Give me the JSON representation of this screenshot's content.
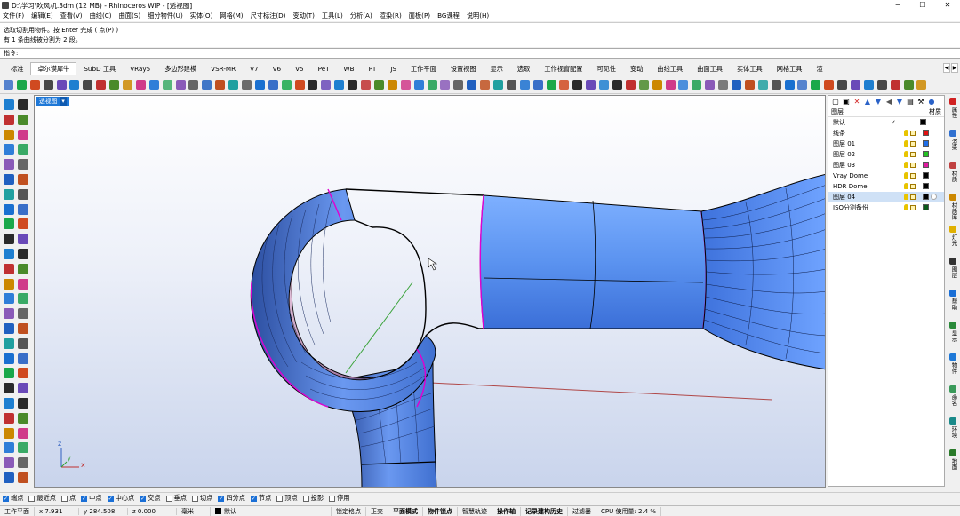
{
  "window": {
    "title": "D:\\学习\\吹风机.3dm (12 MB) - Rhinoceros WIP - [透视图]",
    "min": "─",
    "max": "☐",
    "close": "✕"
  },
  "menu": [
    "文件(F)",
    "编辑(E)",
    "查看(V)",
    "曲线(C)",
    "曲面(S)",
    "细分物件(U)",
    "实体(O)",
    "网格(M)",
    "尺寸标注(D)",
    "变动(T)",
    "工具(L)",
    "分析(A)",
    "渲染(R)",
    "面板(P)",
    "BG课程",
    "说明(H)"
  ],
  "command_history": [
    "选取切割用物件。按 Enter 完成 ( 点(P) )",
    "有 1 条曲线被分割为 2 段。"
  ],
  "command_prompt": "指令:",
  "toolbar_tabs": [
    {
      "label": "标准",
      "active": false
    },
    {
      "label": "卓尔谟犀牛",
      "active": true
    },
    {
      "label": "SubD 工具",
      "active": false
    },
    {
      "label": "VRay5",
      "active": false
    },
    {
      "label": "多边形建模",
      "active": false
    },
    {
      "label": "VSR-MR",
      "active": false
    },
    {
      "label": "V7",
      "active": false
    },
    {
      "label": "V6",
      "active": false
    },
    {
      "label": "V5",
      "active": false
    },
    {
      "label": "PeT",
      "active": false
    },
    {
      "label": "WB",
      "active": false
    },
    {
      "label": "PT",
      "active": false
    },
    {
      "label": "JS",
      "active": false
    },
    {
      "label": "工作平面",
      "active": false
    },
    {
      "label": "设置视图",
      "active": false
    },
    {
      "label": "显示",
      "active": false
    },
    {
      "label": "选取",
      "active": false
    },
    {
      "label": "工作视窗配置",
      "active": false
    },
    {
      "label": "可见性",
      "active": false
    },
    {
      "label": "变动",
      "active": false
    },
    {
      "label": "曲线工具",
      "active": false
    },
    {
      "label": "曲面工具",
      "active": false
    },
    {
      "label": "实体工具",
      "active": false
    },
    {
      "label": "网格工具",
      "active": false
    },
    {
      "label": "渲",
      "active": false
    }
  ],
  "tab_scroll": {
    "left": "◀",
    "right": "▶"
  },
  "viewport": {
    "label": "透视图",
    "dropdown": "▾",
    "axis_x": "x",
    "axis_y": "y",
    "axis_z": "z"
  },
  "layers_panel": {
    "header_left": "图层",
    "header_right": "材质",
    "layers": [
      {
        "name": "默认",
        "current": true,
        "color": "#000000",
        "selected": false
      },
      {
        "name": "线条",
        "current": false,
        "color": "#e01010",
        "selected": false
      },
      {
        "name": "图层 01",
        "current": false,
        "color": "#1e6ee8",
        "selected": false
      },
      {
        "name": "图层 02",
        "current": false,
        "color": "#22c022",
        "selected": false
      },
      {
        "name": "图层 03",
        "current": false,
        "color": "#e01aa0",
        "selected": false
      },
      {
        "name": "Vray Dome",
        "current": false,
        "color": "#000000",
        "selected": false
      },
      {
        "name": "HDR Dome",
        "current": false,
        "color": "#000000",
        "selected": false
      },
      {
        "name": "图层 04",
        "current": false,
        "color": "#000000",
        "selected": true
      },
      {
        "name": "ISO分割备份",
        "current": false,
        "color": "#0a5a1a",
        "selected": false
      }
    ],
    "current_mark": "✓"
  },
  "right_tabs": [
    "属性",
    "渲染",
    "材质",
    "材质库",
    "灯光",
    "图层",
    "帮助",
    "显示",
    "物件",
    "命名",
    "环境",
    "地面"
  ],
  "osnaps": [
    {
      "label": "端点",
      "on": true
    },
    {
      "label": "最近点",
      "on": false
    },
    {
      "label": "点",
      "on": false
    },
    {
      "label": "中点",
      "on": true
    },
    {
      "label": "中心点",
      "on": true
    },
    {
      "label": "交点",
      "on": true
    },
    {
      "label": "垂点",
      "on": false
    },
    {
      "label": "切点",
      "on": false
    },
    {
      "label": "四分点",
      "on": true
    },
    {
      "label": "节点",
      "on": true
    },
    {
      "label": "顶点",
      "on": false
    },
    {
      "label": "投影",
      "on": false
    },
    {
      "label": "停用",
      "on": false
    }
  ],
  "status": {
    "cplane": "工作平面",
    "x": "x 7.931",
    "y": "y 284.508",
    "z": "z 0.000",
    "unit": "毫米",
    "layer": "默认",
    "toggles": [
      "锁定格点",
      "正交",
      "平面模式",
      "物件锁点",
      "智慧轨迹",
      "操作轴",
      "记录建构历史",
      "过滤器"
    ],
    "cpu": "CPU 使用量: 2.4 %"
  },
  "colors": {
    "accent": "#1e78d7",
    "surface": "#5b93f0",
    "edge_highlight": "#e000d0"
  }
}
